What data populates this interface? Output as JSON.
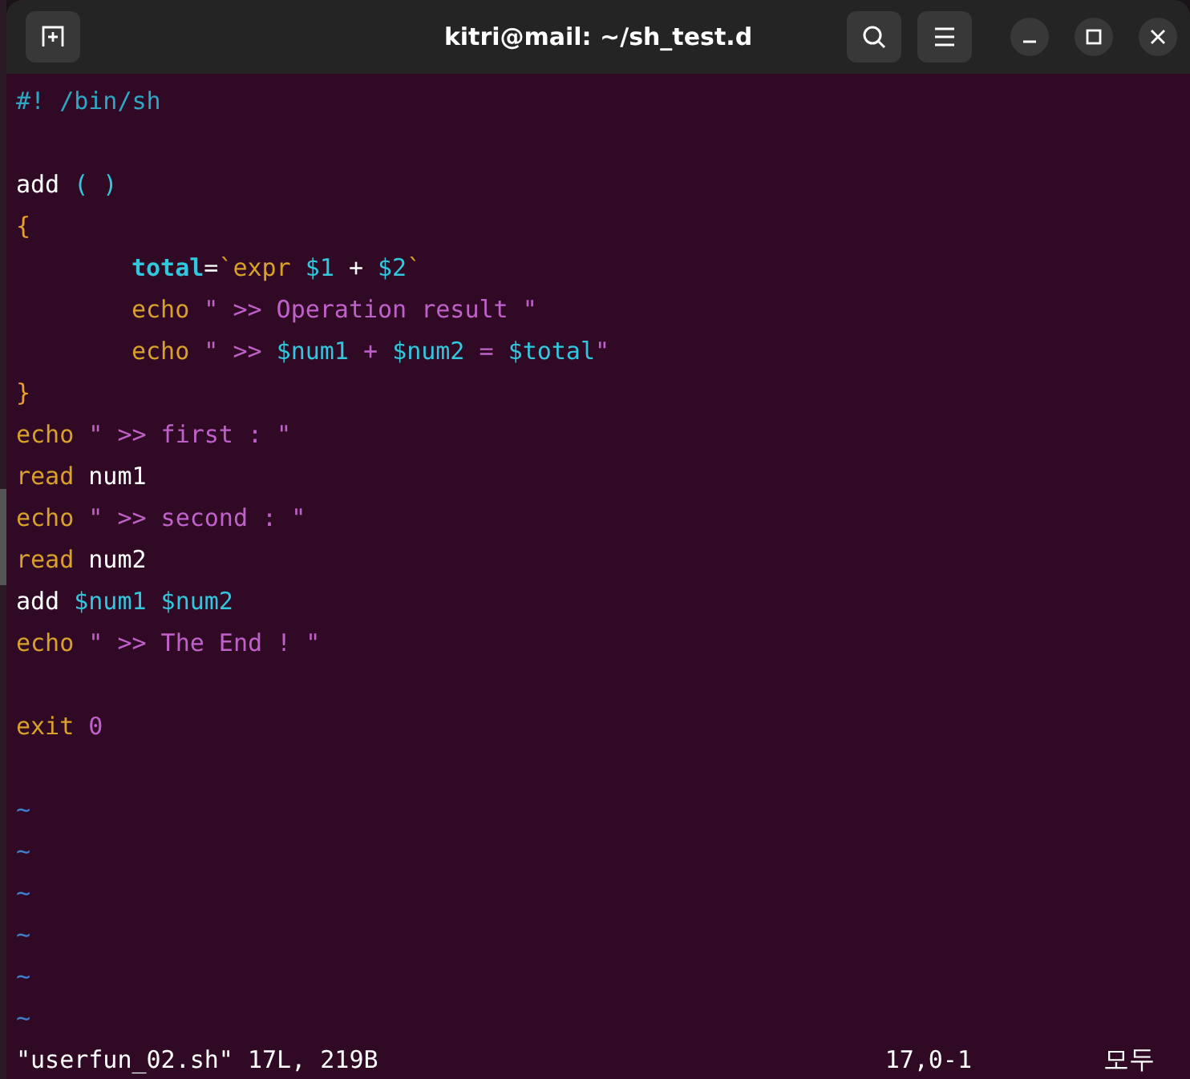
{
  "window": {
    "title": "kitri@mail: ~/sh_test.d"
  },
  "editor": {
    "lines": [
      {
        "tokens": [
          {
            "text": "#! /bin/sh",
            "kind": "comment"
          }
        ]
      },
      {
        "kind": "blank"
      },
      {
        "tokens": [
          {
            "text": "add ",
            "kind": "plain"
          },
          {
            "text": "( )",
            "kind": "paren"
          }
        ]
      },
      {
        "tokens": [
          {
            "text": "{",
            "kind": "brace"
          }
        ],
        "children": [
          {
            "tokens": [
              {
                "text": "total",
                "kind": "assign"
              },
              {
                "text": "=",
                "kind": "plain"
              },
              {
                "text": "`expr ",
                "kind": "keyword"
              },
              {
                "text": "$1",
                "kind": "variable"
              },
              {
                "text": " + ",
                "kind": "plain"
              },
              {
                "text": "$2",
                "kind": "variable"
              },
              {
                "text": "`",
                "kind": "keyword"
              }
            ]
          },
          {
            "tokens": [
              {
                "text": "echo ",
                "kind": "keyword"
              },
              {
                "text": "\" >> Operation result \"",
                "kind": "string"
              }
            ]
          },
          {
            "tokens": [
              {
                "text": "echo ",
                "kind": "keyword"
              },
              {
                "text": "\" >> ",
                "kind": "string"
              },
              {
                "text": "$num1",
                "kind": "variable"
              },
              {
                "text": " + ",
                "kind": "string"
              },
              {
                "text": "$num2",
                "kind": "variable"
              },
              {
                "text": " = ",
                "kind": "string"
              },
              {
                "text": "$total",
                "kind": "variable"
              },
              {
                "text": "\"",
                "kind": "string"
              }
            ]
          }
        ]
      },
      {
        "tokens": [
          {
            "text": "}",
            "kind": "brace"
          }
        ]
      },
      {
        "tokens": [
          {
            "text": "echo ",
            "kind": "keyword"
          },
          {
            "text": "\" >> first : \"",
            "kind": "string"
          }
        ]
      },
      {
        "tokens": [
          {
            "text": "read ",
            "kind": "keyword"
          },
          {
            "text": "num1",
            "kind": "plain"
          }
        ]
      },
      {
        "tokens": [
          {
            "text": "echo ",
            "kind": "keyword"
          },
          {
            "text": "\" >> second : \"",
            "kind": "string"
          }
        ]
      },
      {
        "tokens": [
          {
            "text": "read ",
            "kind": "keyword"
          },
          {
            "text": "num2",
            "kind": "plain"
          }
        ]
      },
      {
        "tokens": [
          {
            "text": "add ",
            "kind": "plain"
          },
          {
            "text": "$num1 $num2",
            "kind": "variable"
          }
        ]
      },
      {
        "tokens": [
          {
            "text": "echo ",
            "kind": "keyword"
          },
          {
            "text": "\" >> The End ! \"",
            "kind": "string"
          }
        ]
      },
      {
        "kind": "blank"
      },
      {
        "tokens": [
          {
            "text": "exit ",
            "kind": "keyword"
          },
          {
            "text": "0",
            "kind": "number"
          }
        ]
      },
      {
        "kind": "blank"
      },
      {
        "tokens": [
          {
            "text": "~",
            "kind": "tilde"
          }
        ]
      },
      {
        "tokens": [
          {
            "text": "~",
            "kind": "tilde"
          }
        ]
      },
      {
        "tokens": [
          {
            "text": "~",
            "kind": "tilde"
          }
        ]
      },
      {
        "tokens": [
          {
            "text": "~",
            "kind": "tilde"
          }
        ]
      },
      {
        "tokens": [
          {
            "text": "~",
            "kind": "tilde"
          }
        ]
      },
      {
        "tokens": [
          {
            "text": "~",
            "kind": "tilde"
          }
        ]
      }
    ]
  },
  "status_bar": {
    "file_info": "\"userfun_02.sh\" 17L, 219B",
    "position": "17,0-1",
    "scroll": "모두"
  }
}
